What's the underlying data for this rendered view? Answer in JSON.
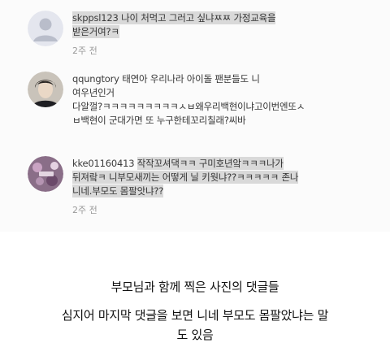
{
  "comments": [
    {
      "username": "skppsl123",
      "lines": [
        "나이 처먹고 그러고 싶냐ㅉㅉ 가정교육을",
        "받은거여?ㅋ"
      ],
      "time": "2주 전"
    },
    {
      "username": "qqungtory",
      "lines": [
        "태연아 우리나라 아이돌 팬분들도 니",
        "여우년인거",
        "다알껄?ㅋㅋㅋㅋㅋㅋㅋㅋㅋㅅㅂ왜우리백현이냐고이번엔또ㅅ",
        "ㅂ백현이 군대가면  또 누구한테꼬리칠래?씨바"
      ],
      "time": ""
    },
    {
      "username": "kke01160413",
      "lines": [
        "작작꼬셔댁ㅋㅋ 구미호년앜ㅋㅋㅋ나가",
        "뒤져랔ㅋ 니부모새끼는 어떻게 닐 키웟냐??ㅋㅋㅋㅋㅋ 존나",
        "니네.부모도 몸팔앗냐??"
      ],
      "time": "2주 전"
    }
  ],
  "caption": {
    "line1": "부모님과 함께 찍은 사진의 댓글들",
    "line2": "심지어 마지막 댓글을 보면 니네 부모도 몸팔았냐는 말",
    "line3": "도 있음"
  }
}
